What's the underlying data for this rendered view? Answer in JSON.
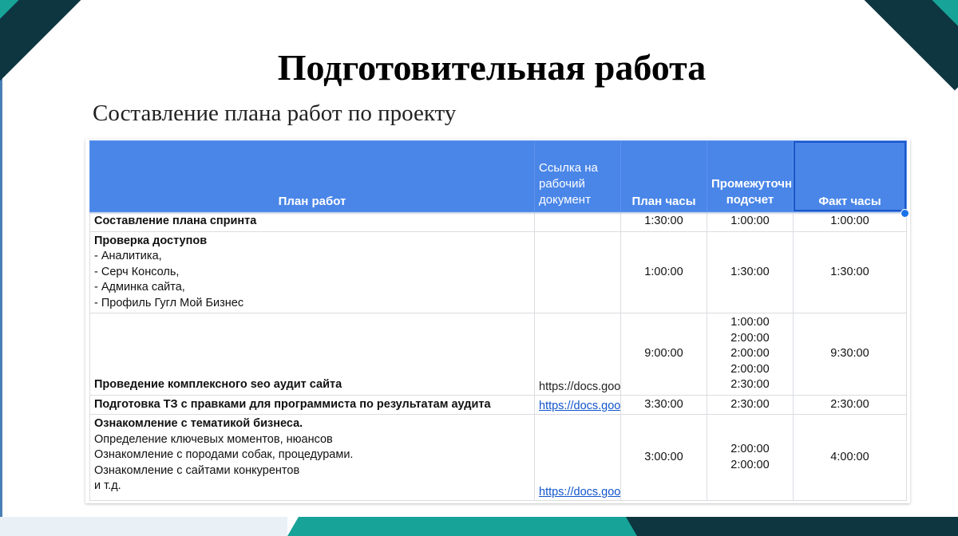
{
  "slide": {
    "title": "Подготовительная работа",
    "subtitle": "Составление плана работ по проекту",
    "colors": {
      "accent_teal": "#17a398",
      "accent_dark": "#0d3640",
      "header_blue": "#4a86e8",
      "link_blue": "#1155cc"
    }
  },
  "table": {
    "headers": {
      "plan": "План работ",
      "link": "Ссылка на рабочий документ",
      "plan_hours": "План часы",
      "interim": "Промежуточный подсчет",
      "actual": "Факт часы"
    },
    "rows": [
      {
        "title": "Составление плана спринта",
        "details": [],
        "link": "",
        "plan_hours": "1:30:00",
        "interim": [
          "1:00:00"
        ],
        "actual": "1:00:00"
      },
      {
        "title": "Проверка доступов",
        "details": [
          "- Аналитика,",
          "- Серч Консоль,",
          "- Админка сайта,",
          "- Профиль Гугл Мой Бизнес"
        ],
        "link": "",
        "plan_hours": "1:00:00",
        "interim": [
          "1:30:00"
        ],
        "actual": "1:30:00"
      },
      {
        "title": "Проведение комплексного seo аудит сайта",
        "details": [],
        "link": "https://docs.goo",
        "plan_hours": "9:00:00",
        "interim": [
          "1:00:00",
          "2:00:00",
          "2:00:00",
          "2:00:00",
          "2:30:00"
        ],
        "actual": "9:30:00"
      },
      {
        "title": "Подготовка ТЗ с правками для программиста по результатам аудита",
        "details": [],
        "link": "https://docs.goo",
        "plan_hours": "3:30:00",
        "interim": [
          "2:30:00"
        ],
        "actual": "2:30:00"
      },
      {
        "title": "Ознакомление с тематикой бизнеса.",
        "details": [
          "Определение ключевых моментов, нюансов",
          "Ознакомление с породами собак, процедурами.",
          "Ознакомление с сайтами конкурентов",
          "и т.д."
        ],
        "link": "https://docs.goo",
        "plan_hours": "3:00:00",
        "interim": [
          "2:00:00",
          "2:00:00"
        ],
        "actual": "4:00:00"
      }
    ]
  }
}
